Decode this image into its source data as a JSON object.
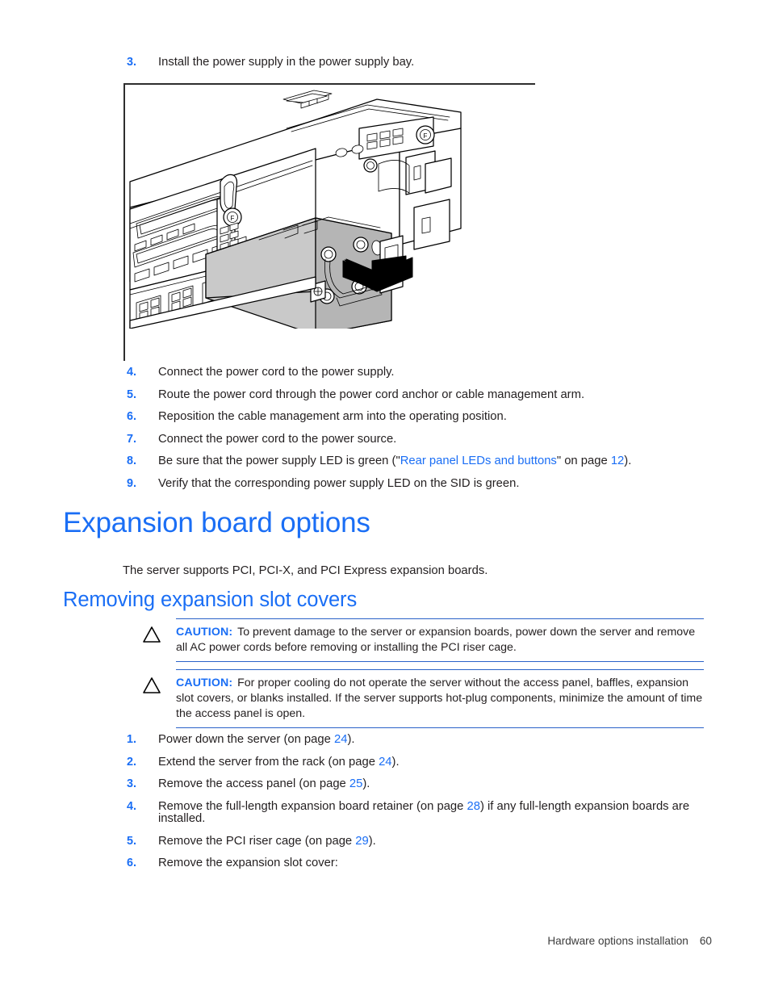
{
  "document": {
    "title": "Hardware options installation",
    "page_number": "60"
  },
  "figure_step": {
    "number": "3.",
    "text": "Install the power supply in the power supply bay."
  },
  "figure": {
    "caption": "",
    "alt": "Line drawing of server rear panel with hot-plug power supply being inserted into the power supply bay, arrow indicating insertion direction",
    "shading_color": "#c9c9c9",
    "line_color": "#000000"
  },
  "steps_power_supply": [
    {
      "number": "4.",
      "text": "Connect the power cord to the power supply."
    },
    {
      "number": "5.",
      "text": "Route the power cord through the power cord anchor or cable management arm."
    },
    {
      "number": "6.",
      "text": "Reposition the cable management arm into the operating position."
    },
    {
      "number": "7.",
      "text": "Connect the power cord to the power source."
    },
    {
      "number": "8.",
      "prefix": "Be sure that the power supply LED is green (\"",
      "link": "Rear panel LEDs and buttons",
      "middle": "\" on page ",
      "page": "12",
      "suffix": ")."
    },
    {
      "number": "9.",
      "text": "Verify that the corresponding power supply LED on the SID is green."
    }
  ],
  "headings": {
    "h1": "Expansion board options",
    "h2": "Removing expansion slot covers"
  },
  "intro_paragraph": "The server supports PCI, PCI-X, and PCI Express expansion boards.",
  "cautions": [
    {
      "label": "CAUTION:",
      "text": "To prevent damage to the server or expansion boards, power down the server and remove all AC power cords before removing or installing the PCI riser cage."
    },
    {
      "label": "CAUTION:",
      "text": "For proper cooling do not operate the server without the access panel, baffles, expansion slot covers, or blanks installed. If the server supports hot-plug components, minimize the amount of time the access panel is open."
    }
  ],
  "steps_removing_covers": [
    {
      "number": "1.",
      "prefix": "Power down the server (on page ",
      "page": "24",
      "suffix": ")."
    },
    {
      "number": "2.",
      "prefix": "Extend the server from the rack (on page ",
      "page": "24",
      "suffix": ")."
    },
    {
      "number": "3.",
      "prefix": "Remove the access panel (on page ",
      "page": "25",
      "suffix": ")."
    },
    {
      "number": "4.",
      "prefix": "Remove the full-length expansion board retainer (on page ",
      "page": "28",
      "suffix": ") if any full-length expansion boards are installed."
    },
    {
      "number": "5.",
      "prefix": "Remove the PCI riser cage (on page ",
      "page": "29",
      "suffix": ")."
    },
    {
      "number": "6.",
      "prefix": "Remove the expansion slot cover:",
      "page": "",
      "suffix": ""
    }
  ],
  "colors": {
    "accent_blue": "#1a6ef5",
    "rule_blue": "#2a62c8",
    "body_text": "#231f20"
  }
}
